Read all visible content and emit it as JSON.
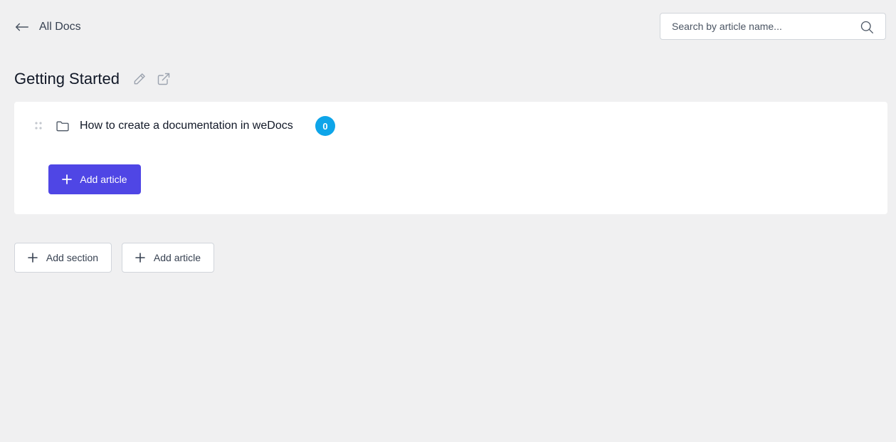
{
  "topbar": {
    "back_label": "All Docs",
    "search_placeholder": "Search by article name..."
  },
  "doc": {
    "title": "Getting Started"
  },
  "sections": [
    {
      "title": "How to create a documentation in weDocs",
      "article_count": "0",
      "add_article_label": "Add article"
    }
  ],
  "footer_actions": {
    "add_section_label": "Add section",
    "add_article_label": "Add article"
  },
  "colors": {
    "primary": "#4f46e5",
    "badge": "#0ea5e9",
    "background": "#f0f0f1"
  },
  "icons": [
    "arrow-left-icon",
    "search-icon",
    "pencil-icon",
    "external-link-icon",
    "drag-handle-icon",
    "folder-icon",
    "plus-icon"
  ]
}
